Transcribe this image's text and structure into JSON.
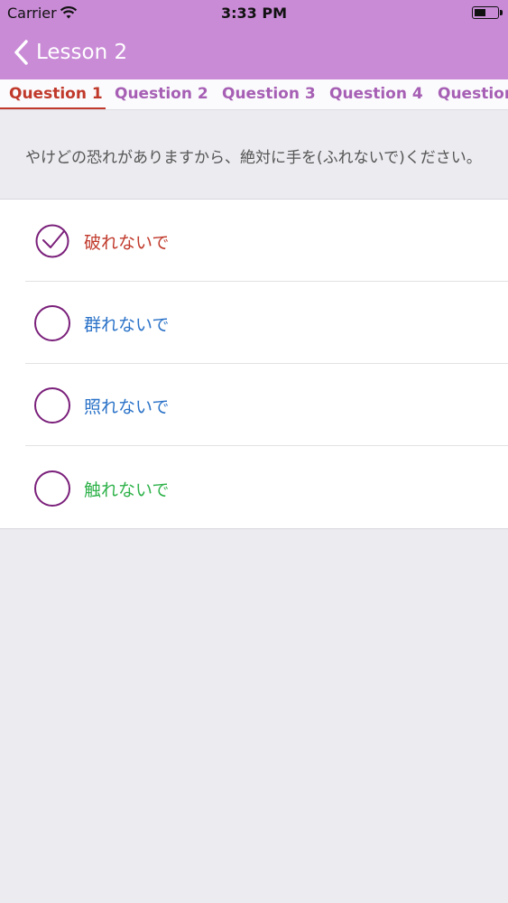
{
  "status_bar": {
    "carrier": "Carrier",
    "time": "3:33 PM"
  },
  "nav": {
    "back_label": "Lesson 2"
  },
  "tabs": [
    {
      "label": "Question 1",
      "active": true
    },
    {
      "label": "Question 2",
      "active": false
    },
    {
      "label": "Question 3",
      "active": false
    },
    {
      "label": "Question 4",
      "active": false
    },
    {
      "label": "Question",
      "active": false
    }
  ],
  "question": {
    "text": "やけどの恐れがありますから、絶対に手を(ふれないで)ください。"
  },
  "options": [
    {
      "label": "破れないで",
      "selected": true,
      "color": "#c0392b"
    },
    {
      "label": "群れないで",
      "selected": false,
      "color": "#2a72c8"
    },
    {
      "label": "照れないで",
      "selected": false,
      "color": "#2a72c8"
    },
    {
      "label": "触れないで",
      "selected": false,
      "color": "#2fb24a"
    }
  ],
  "colors": {
    "header": "#c98bd6",
    "tab_text": "#a65fb4",
    "tab_active": "#c0392b",
    "radio_border": "#7a1f7a",
    "background": "#ebebf0"
  }
}
